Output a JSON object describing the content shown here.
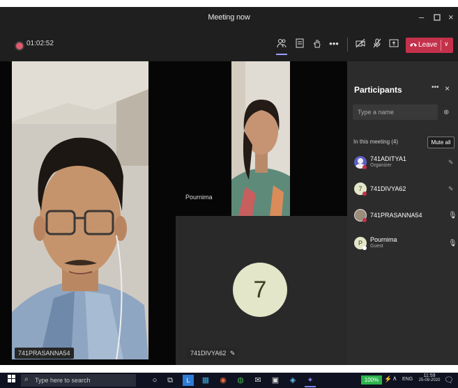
{
  "window": {
    "title": "Meeting now"
  },
  "toolbar": {
    "timer": "01:02:52",
    "leave_label": "Leave"
  },
  "stage": {
    "tile_main_name": "741PRASANNA54",
    "tile_pournima_name": "Pournima",
    "tile_divya_name": "741DIVYA62",
    "avatar_number": "7"
  },
  "participants": {
    "title": "Participants",
    "search_placeholder": "Type a name",
    "section_label": "In this meeting (4)",
    "mute_all_label": "Mute all",
    "list": [
      {
        "name": "741ADITYA1",
        "role": "Organizer",
        "avatar_color": "#5b5fc7",
        "mic": "muted"
      },
      {
        "name": "741DIVYA62",
        "role": "",
        "avatar_color": "#d4d8b8",
        "mic": "muted"
      },
      {
        "name": "741PRASANNA54",
        "role": "",
        "avatar_color": "#9c8c7a",
        "mic": "on"
      },
      {
        "name": "Pournima",
        "role": "Guest",
        "avatar_color": "#d4d8b8",
        "mic": "on"
      }
    ]
  },
  "taskbar": {
    "search_placeholder": "Type here to search",
    "battery": "100%",
    "lang": "ENG",
    "time": "11:59",
    "date": "25-09-2020"
  },
  "colors": {
    "accent": "#5b5fc7",
    "leave": "#c4314b",
    "avatar_bg": "#e3e6c9"
  }
}
